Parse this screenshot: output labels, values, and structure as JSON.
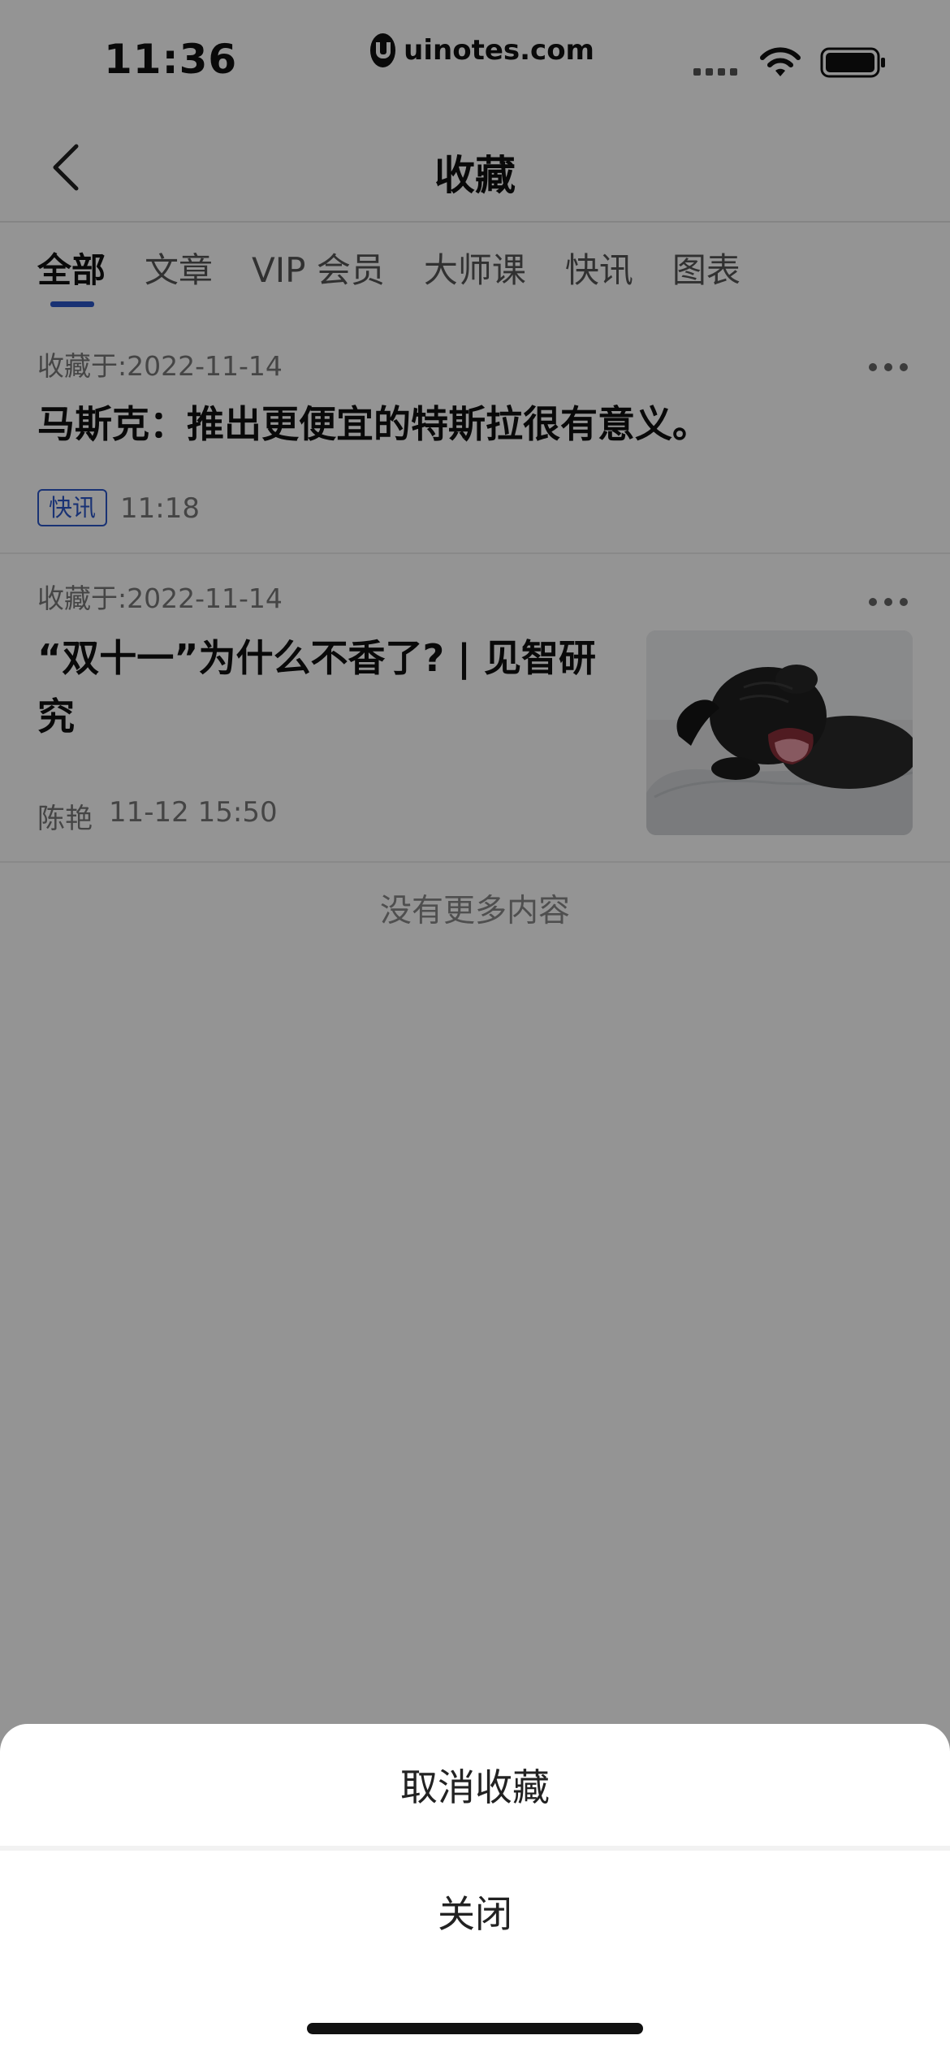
{
  "status_bar": {
    "time": "11:36",
    "url": "uinotes.com",
    "icons": [
      "signal-icon",
      "wifi-icon",
      "battery-icon"
    ]
  },
  "nav": {
    "title": "收藏",
    "back_icon": "chevron-left-icon"
  },
  "tabs": [
    {
      "label": "全部",
      "active": true
    },
    {
      "label": "文章",
      "active": false
    },
    {
      "label": "VIP 会员",
      "active": false
    },
    {
      "label": "大师课",
      "active": false
    },
    {
      "label": "快讯",
      "active": false
    },
    {
      "label": "图表",
      "active": false
    }
  ],
  "items": [
    {
      "fav_date": "收藏于:2022-11-14",
      "title": "马斯克：推出更便宜的特斯拉很有意义。",
      "badge": "快讯",
      "time": "11:18"
    },
    {
      "fav_date": "收藏于:2022-11-14",
      "title_line1": "“双十一”为什么不香了? | 见智研",
      "title_line2": "究",
      "author": "陈艳",
      "time": "11-12 15:50",
      "thumbnail": "pug-yawning-image"
    }
  ],
  "no_more": "没有更多内容",
  "sheet": {
    "unfavorite": "取消收藏",
    "close": "关闭"
  },
  "colors": {
    "accent": "#2b56c9",
    "overlay": "rgba(0,0,0,0.42)"
  }
}
